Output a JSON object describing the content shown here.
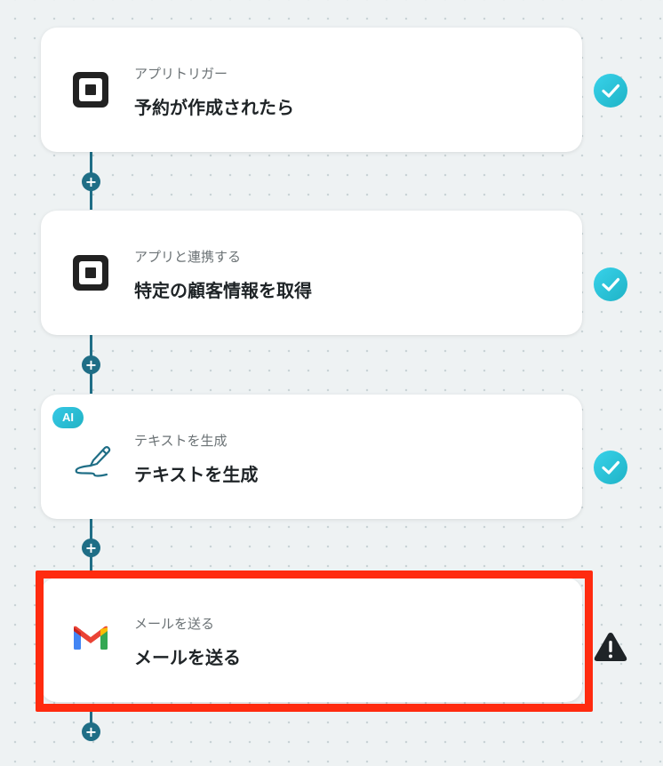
{
  "steps": [
    {
      "subtitle": "アプリトリガー",
      "title": "予約が作成されたら",
      "icon": "square-app-icon",
      "status": "check"
    },
    {
      "subtitle": "アプリと連携する",
      "title": "特定の顧客情報を取得",
      "icon": "square-app-icon",
      "status": "check"
    },
    {
      "subtitle": "テキストを生成",
      "title": "テキストを生成",
      "icon": "pencil-icon",
      "badge": "AI",
      "status": "check"
    },
    {
      "subtitle": "メールを送る",
      "title": "メールを送る",
      "icon": "gmail-icon",
      "status": "warning"
    }
  ],
  "add_button_label": "+",
  "colors": {
    "connector": "#1f6e86",
    "check": "#24bfd6",
    "warning": "#1f2427",
    "highlight": "#ff2b0f"
  }
}
